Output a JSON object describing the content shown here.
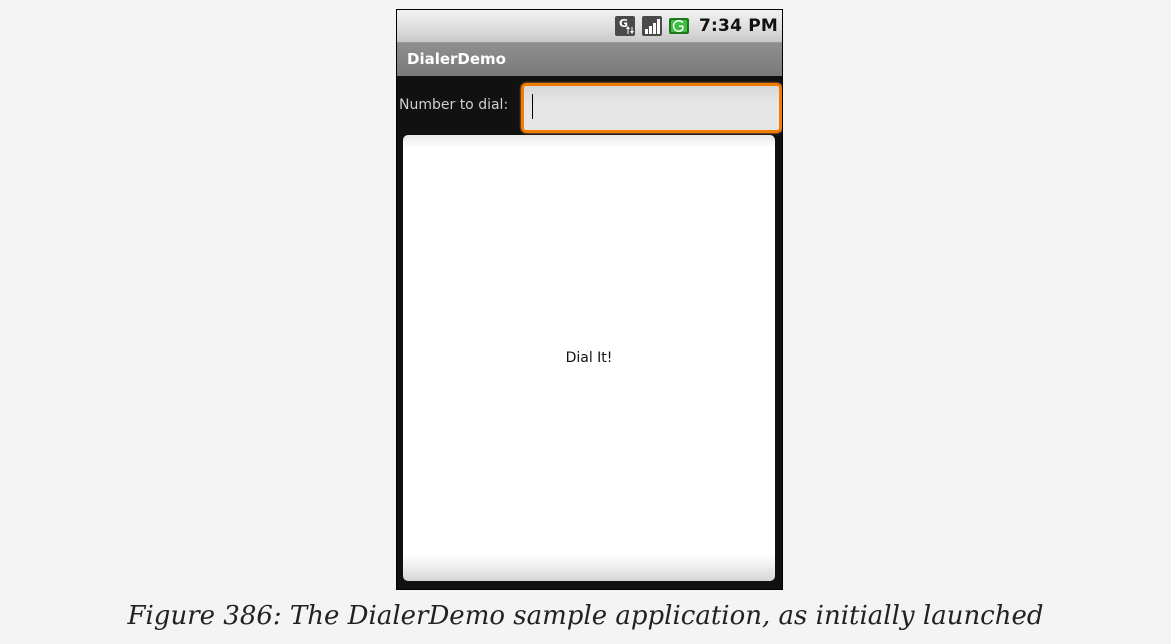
{
  "status_bar": {
    "time": "7:34 PM",
    "icons": [
      "g-data-icon",
      "signal-strength-icon",
      "battery-charging-icon"
    ]
  },
  "app": {
    "title": "DialerDemo"
  },
  "form": {
    "label": "Number to dial:",
    "value": "",
    "placeholder": ""
  },
  "button": {
    "label": "Dial It!"
  },
  "caption": "Figure 386: The DialerDemo sample application, as initially launched",
  "colors": {
    "focus_border": "#f07c00",
    "title_bar": "#868686",
    "background": "#111111"
  }
}
